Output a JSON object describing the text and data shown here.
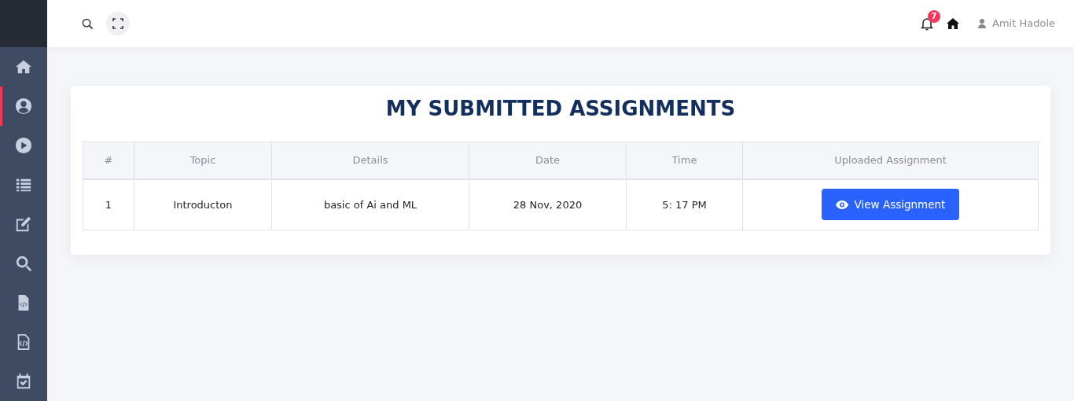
{
  "sidebar": {
    "items": [
      {
        "selected": false
      },
      {
        "selected": true
      },
      {
        "selected": false
      },
      {
        "selected": false
      },
      {
        "selected": false
      },
      {
        "selected": false
      },
      {
        "selected": false
      },
      {
        "selected": false
      },
      {
        "selected": false
      }
    ]
  },
  "header": {
    "notification_count": "7",
    "user_name": "Amit Hadole"
  },
  "title": "MY SUBMITTED ASSIGNMENTS",
  "table": {
    "columns": [
      "#",
      "Topic",
      "Details",
      "Date",
      "Time",
      "Uploaded Assignment"
    ],
    "rows": [
      {
        "cells": [
          "1",
          "Introducton",
          "basic of Ai and ML",
          "28 Nov, 2020",
          "5: 17 PM"
        ],
        "button": "View Assignment"
      }
    ]
  }
}
